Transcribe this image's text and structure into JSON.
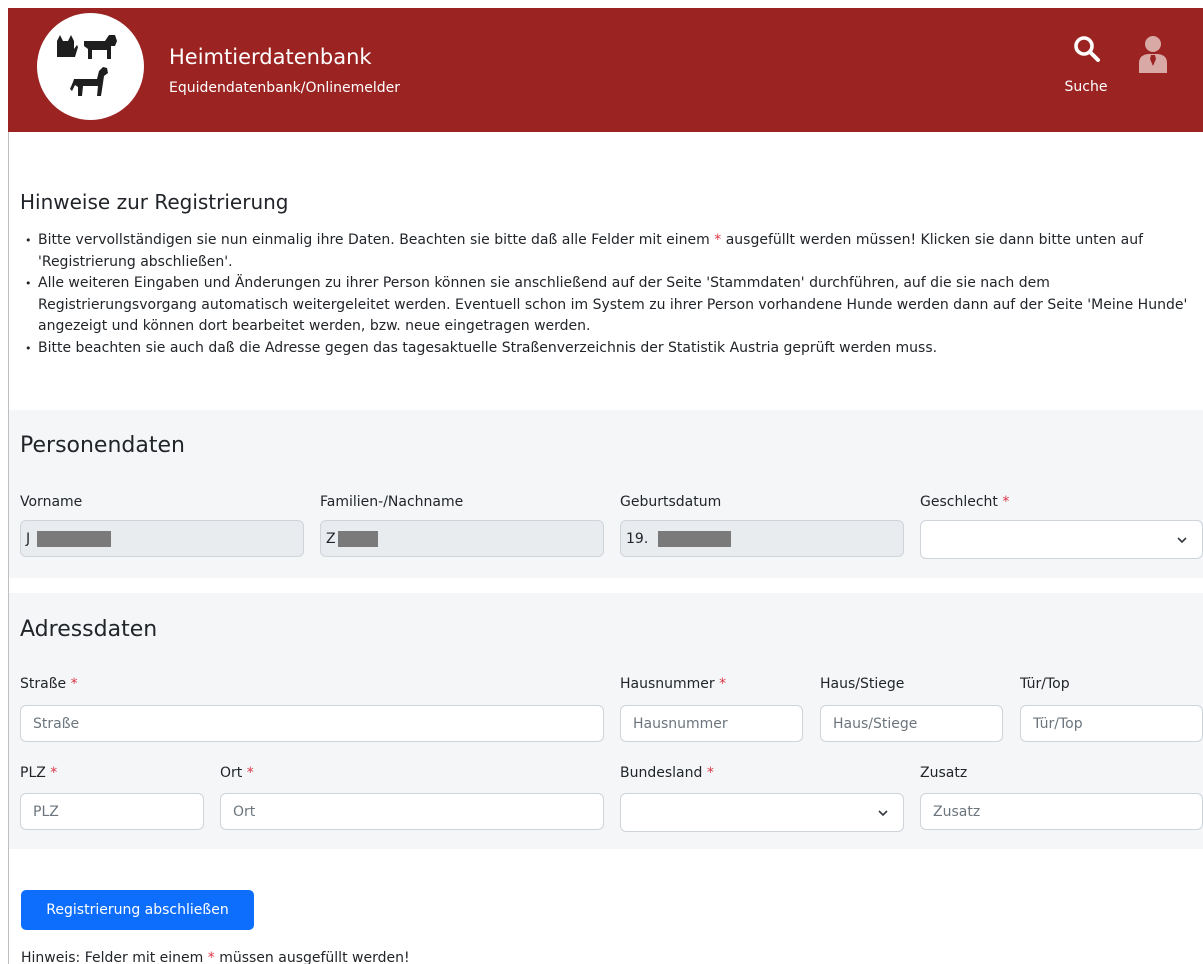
{
  "header": {
    "title": "Heimtierdatenbank",
    "subtitle": "Equidendatenbank/Onlinemelder",
    "search_label": "Suche",
    "icons": [
      "cat-icon",
      "dog-icon",
      "horse-icon",
      "search-icon",
      "user-icon"
    ],
    "color": "#9b2423"
  },
  "hints": {
    "title": "Hinweise zur Registrierung",
    "items": [
      {
        "before": "Bitte vervollständigen sie nun einmalig ihre Daten. Beachten sie bitte daß alle Felder mit einem ",
        "star": "*",
        "after": " ausgefüllt werden müssen! Klicken sie dann bitte unten auf 'Registrierung abschließen'."
      },
      {
        "text": "Alle weiteren Eingaben und Änderungen zu ihrer Person können sie anschließend auf der Seite 'Stammdaten' durchführen, auf die sie nach dem Registrierungsvorgang automatisch weitergeleitet werden. Eventuell schon im System zu ihrer Person vorhandene Hunde werden dann auf der Seite 'Meine Hunde' angezeigt und können dort bearbeitet werden, bzw. neue eingetragen werden."
      },
      {
        "text": "Bitte beachten sie auch daß die Adresse gegen das tagesaktuelle Straßenverzeichnis der Statistik Austria geprüft werden muss."
      }
    ]
  },
  "personen": {
    "title": "Personendaten",
    "vorname": {
      "label": "Vorname",
      "value": "J"
    },
    "nachname": {
      "label": "Familien-/Nachname",
      "value": "Z"
    },
    "geburtsdatum": {
      "label": "Geburtsdatum",
      "value": "19."
    },
    "geschlecht": {
      "label": "Geschlecht",
      "value": ""
    }
  },
  "adress": {
    "title": "Adressdaten",
    "strasse": {
      "label": "Straße",
      "placeholder": "Straße"
    },
    "hausnummer": {
      "label": "Hausnummer",
      "placeholder": "Hausnummer"
    },
    "hausstiege": {
      "label": "Haus/Stiege",
      "placeholder": "Haus/Stiege"
    },
    "tuertop": {
      "label": "Tür/Top",
      "placeholder": "Tür/Top"
    },
    "plz": {
      "label": "PLZ",
      "placeholder": "PLZ"
    },
    "ort": {
      "label": "Ort",
      "placeholder": "Ort"
    },
    "bundesland": {
      "label": "Bundesland",
      "value": ""
    },
    "zusatz": {
      "label": "Zusatz",
      "placeholder": "Zusatz"
    }
  },
  "required_marker": "*",
  "submit_label": "Registrierung abschließen",
  "footnote": {
    "before": "Hinweis: Felder mit einem ",
    "star": "*",
    "after": " müssen ausgefüllt werden!"
  },
  "colors": {
    "required": "#dc3545",
    "primary": "#0d6efd",
    "section_bg": "#f5f6f8"
  }
}
